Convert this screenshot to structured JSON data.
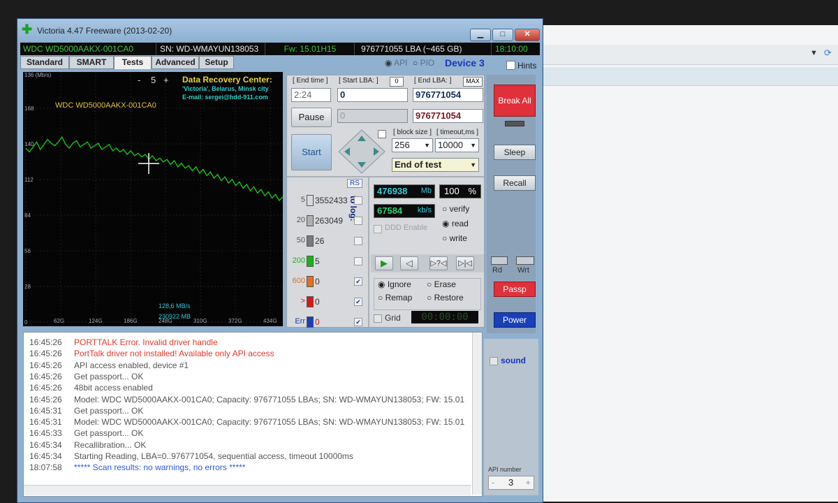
{
  "window": {
    "title": "Victoria 4.47 Freeware (2013-02-20)",
    "buttons": {
      "min": "▁",
      "max": "□",
      "close": "✕"
    }
  },
  "infobar": {
    "model": "WDC WD5000AAKX-001CA0",
    "serial": "SN: WD-WMAYUN138053",
    "firmware": "Fw: 15.01H15",
    "capacity": "976771055 LBA (~465 GB)",
    "clock": "18:10:00"
  },
  "tabs": [
    "Standard",
    "SMART",
    "Tests",
    "Advanced",
    "Setup"
  ],
  "options": {
    "api": "API",
    "pio": "PIO",
    "device": "Device 3",
    "hints": "Hints"
  },
  "graph": {
    "y_top": "136 (Mb/s)",
    "y_ticks": [
      "168",
      "140",
      "112",
      "84",
      "56",
      "28",
      "0"
    ],
    "x_ticks": [
      "62G",
      "124G",
      "186G",
      "248G",
      "310G",
      "372G",
      "434G"
    ],
    "zoom": {
      "minus": "-",
      "value": "5",
      "plus": "+"
    },
    "drive_label": "WDC WD5000AAKX-001CA0",
    "center_title": "Data Recovery Center:",
    "center_sub": "'Victoria', Belarus, Minsk city",
    "center_email": "E-mail: sergei@hdd-911.com",
    "speed": "128,6 MB/s",
    "position": "230922 MB",
    "samples": [
      136,
      133,
      137,
      141,
      135,
      139,
      143,
      140,
      138,
      141,
      145,
      139,
      136,
      140,
      142,
      137,
      139,
      141,
      136,
      138,
      140,
      135,
      137,
      139,
      134,
      136,
      133,
      135,
      131,
      134,
      130,
      132,
      129,
      131,
      127,
      130,
      126,
      128,
      125,
      127,
      123,
      126,
      121,
      124,
      120,
      122,
      118,
      121,
      116,
      119,
      114,
      117,
      112,
      115,
      110,
      113,
      108,
      111,
      106,
      109,
      104,
      107,
      102,
      105,
      100,
      103,
      98,
      101,
      96,
      99,
      94,
      97
    ]
  },
  "controls": {
    "end_time_label": "[ End time ]",
    "end_time": "2:24",
    "start_lba_label": "[ Start LBA: ]",
    "start_lba_zero": "0",
    "start_lba": "0",
    "end_lba_label": "[ End LBA: ]",
    "end_lba_max": "MAX",
    "end_lba": "976771054",
    "pause_label": "Pause",
    "disabled_field": "0",
    "end_lba_2": "976771054",
    "start_label": "Start",
    "block_size_label": "[ block size ]",
    "block_size": "256",
    "timeout_label": "[ timeout,ms ]",
    "timeout": "10000",
    "end_mode": "End of test",
    "rs": "RS",
    "to_log": "to log:",
    "hist": [
      {
        "ms": "5",
        "count": "3552433",
        "color": "#d9d9d9",
        "checked": false
      },
      {
        "ms": "20",
        "count": "263049",
        "color": "#b0b0b0",
        "checked": false
      },
      {
        "ms": "50",
        "count": "26",
        "color": "#7a7a7a",
        "checked": false
      },
      {
        "ms": "200",
        "count": "5",
        "color": "#18b318",
        "checked": false
      },
      {
        "ms": "600",
        "count": "0",
        "color": "#e07020",
        "checked": true
      },
      {
        "ms": ">",
        "count": "0",
        "color": "#d81818",
        "checked": true
      },
      {
        "ms": "Err",
        "count": "0",
        "color": "#1b3fb8",
        "checked": true
      }
    ],
    "mb_value": "476938",
    "mb_unit": "Mb",
    "percent": "100",
    "percent_unit": "%",
    "kbs_value": "67584",
    "kbs_unit": "kb/s",
    "ddd_label": "DDD Enable",
    "modes": [
      "verify",
      "read",
      "write"
    ],
    "selected_mode": "read",
    "actions": [
      "Ignore",
      "Erase",
      "Remap",
      "Restore"
    ],
    "selected_action": "Ignore",
    "grid_label": "Grid",
    "grid_timer": "00:00:00"
  },
  "side": {
    "break": "Break All",
    "sleep": "Sleep",
    "recall": "Recall",
    "rd": "Rd",
    "wrt": "Wrt",
    "passp": "Passp",
    "power": "Power",
    "sound": "sound",
    "api_number_label": "API number",
    "api_number": "3",
    "api_minus": "-",
    "api_plus": "+"
  },
  "log": [
    {
      "time": "16:45:26",
      "text": "PORTTALK Error. Invalid driver handle",
      "color": "#e03a2a"
    },
    {
      "time": "16:45:26",
      "text": "PortTalk driver not installed! Available only API access",
      "color": "#e03a2a"
    },
    {
      "time": "16:45:26",
      "text": "API access enabled, device #1",
      "color": "#555"
    },
    {
      "time": "16:45:26",
      "text": "Get passport... OK",
      "color": "#555"
    },
    {
      "time": "16:45:26",
      "text": "48bit access enabled",
      "color": "#555"
    },
    {
      "time": "16:45:26",
      "text": "Model: WDC WD5000AAKX-001CA0; Capacity: 976771055 LBAs; SN: WD-WMAYUN138053; FW: 15.01",
      "color": "#555"
    },
    {
      "time": "16:45:31",
      "text": "Get passport... OK",
      "color": "#555"
    },
    {
      "time": "16:45:31",
      "text": "Model: WDC WD5000AAKX-001CA0; Capacity: 976771055 LBAs; SN: WD-WMAYUN138053; FW: 15.01",
      "color": "#555"
    },
    {
      "time": "16:45:33",
      "text": "Get passport... OK",
      "color": "#555"
    },
    {
      "time": "16:45:34",
      "text": "Recallibration... OK",
      "color": "#555"
    },
    {
      "time": "16:45:34",
      "text": "Starting Reading, LBA=0..976771054, sequential access, timeout 10000ms",
      "color": "#555"
    },
    {
      "time": "18:07:58",
      "text": "***** Scan results: no warnings, no errors *****",
      "color": "#2a5ad8"
    }
  ]
}
